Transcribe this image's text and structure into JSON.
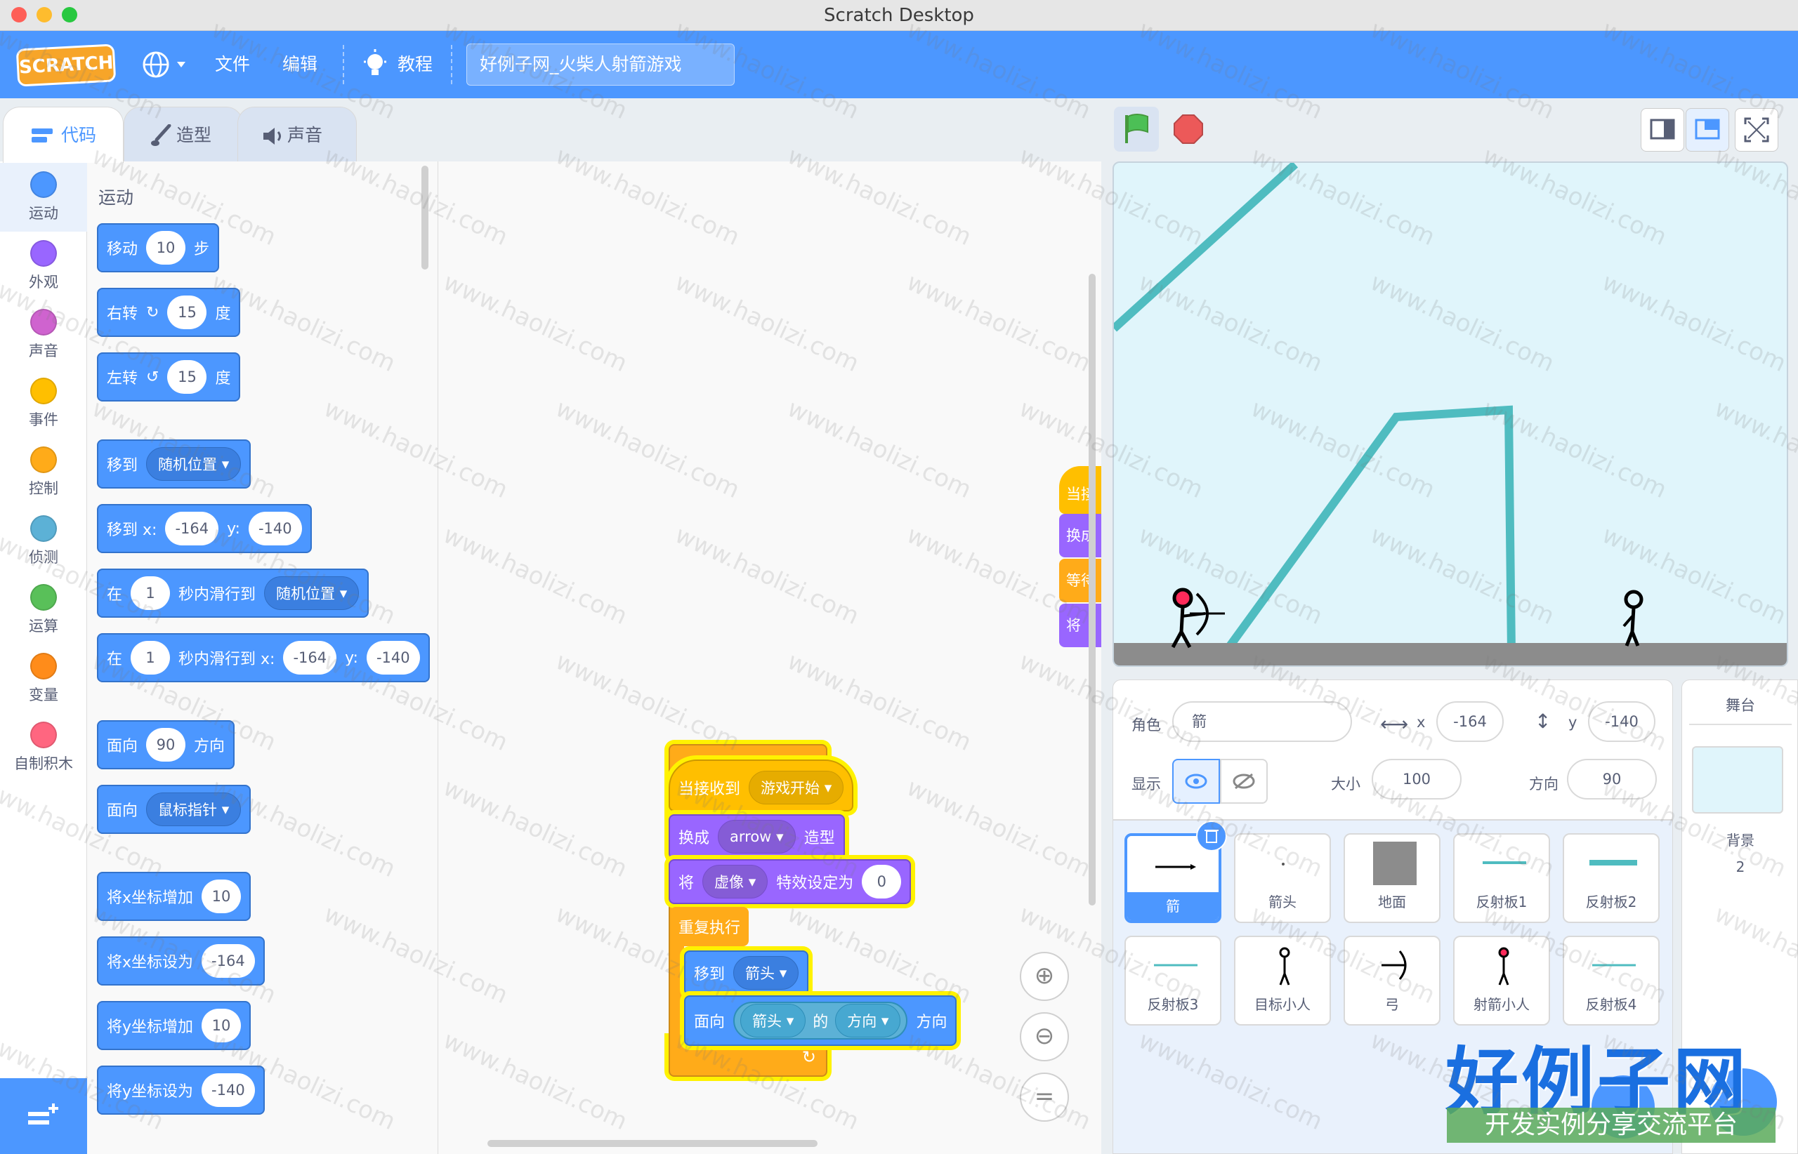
{
  "window": {
    "title": "Scratch Desktop"
  },
  "menubar": {
    "logo": "SCRATCH",
    "items": [
      "文件",
      "编辑",
      "教程"
    ],
    "project_title": "好例子网_火柴人射箭游戏"
  },
  "tabs": [
    {
      "label": "代码",
      "icon": "code-icon",
      "active": true
    },
    {
      "label": "造型",
      "icon": "brush-icon",
      "active": false
    },
    {
      "label": "声音",
      "icon": "speaker-icon",
      "active": false
    }
  ],
  "categories": [
    {
      "label": "运动",
      "color": "#4c97ff"
    },
    {
      "label": "外观",
      "color": "#9966ff"
    },
    {
      "label": "声音",
      "color": "#cf63cf"
    },
    {
      "label": "事件",
      "color": "#ffbf00"
    },
    {
      "label": "控制",
      "color": "#ffab19"
    },
    {
      "label": "侦测",
      "color": "#5cb1d6"
    },
    {
      "label": "运算",
      "color": "#59c059"
    },
    {
      "label": "变量",
      "color": "#ff8c1a"
    },
    {
      "label": "自制积木",
      "color": "#ff6680"
    }
  ],
  "palette": {
    "section": "运动",
    "move": {
      "a": "移动",
      "v": "10",
      "b": "步"
    },
    "turn_right": {
      "a": "右转",
      "v": "15",
      "b": "度"
    },
    "turn_left": {
      "a": "左转",
      "v": "15",
      "b": "度"
    },
    "goto": {
      "a": "移到",
      "d": "随机位置"
    },
    "goto_xy": {
      "a": "移到 x:",
      "x": "-164",
      "yl": "y:",
      "y": "-140"
    },
    "glide": {
      "a": "在",
      "v": "1",
      "b": "秒内滑行到",
      "d": "随机位置"
    },
    "glide_xy": {
      "a": "在",
      "v": "1",
      "b": "秒内滑行到 x:",
      "x": "-164",
      "yl": "y:",
      "y": "-140"
    },
    "point": {
      "a": "面向",
      "v": "90",
      "b": "方向"
    },
    "point_towards": {
      "a": "面向",
      "d": "鼠标指针"
    },
    "change_x": {
      "a": "将x坐标增加",
      "v": "10"
    },
    "set_x": {
      "a": "将x坐标设为",
      "v": "-164"
    },
    "change_y": {
      "a": "将y坐标增加",
      "v": "10"
    },
    "set_y": {
      "a": "将y坐标设为",
      "v": "-140"
    }
  },
  "script": {
    "hat": {
      "a": "当接收到",
      "d": "游戏开始"
    },
    "costume": {
      "a": "换成",
      "d": "arrow",
      "b": "造型"
    },
    "effect": {
      "a": "将",
      "d": "虚像",
      "b": "特效设定为",
      "v": "0"
    },
    "forever": "重复执行",
    "goto": {
      "a": "移到",
      "d": "箭头"
    },
    "point": {
      "a": "面向",
      "d1": "箭头",
      "of": "的",
      "d2": "方向",
      "b": "方向"
    }
  },
  "offscreen_blocks": [
    "当接",
    "换成",
    "等待",
    "将"
  ],
  "sprite_info": {
    "sprite_label": "角色",
    "sprite_name": "箭",
    "x_label": "x",
    "x": "-164",
    "y_label": "y",
    "y": "-140",
    "show_label": "显示",
    "size_label": "大小",
    "size": "100",
    "direction_label": "方向",
    "direction": "90"
  },
  "sprites": [
    {
      "name": "箭",
      "selected": true
    },
    {
      "name": "箭头"
    },
    {
      "name": "地面"
    },
    {
      "name": "反射板1"
    },
    {
      "name": "反射板2"
    },
    {
      "name": "反射板3"
    },
    {
      "name": "目标小人"
    },
    {
      "name": "弓"
    },
    {
      "name": "射箭小人"
    },
    {
      "name": "反射板4"
    }
  ],
  "stage_panel": {
    "title": "舞台",
    "backdrops_label": "背景",
    "backdrops_count": "2"
  },
  "watermark": {
    "url": "www.haolizi.com",
    "logo": "好例子网",
    "tagline": "开发实例分享交流平台"
  }
}
